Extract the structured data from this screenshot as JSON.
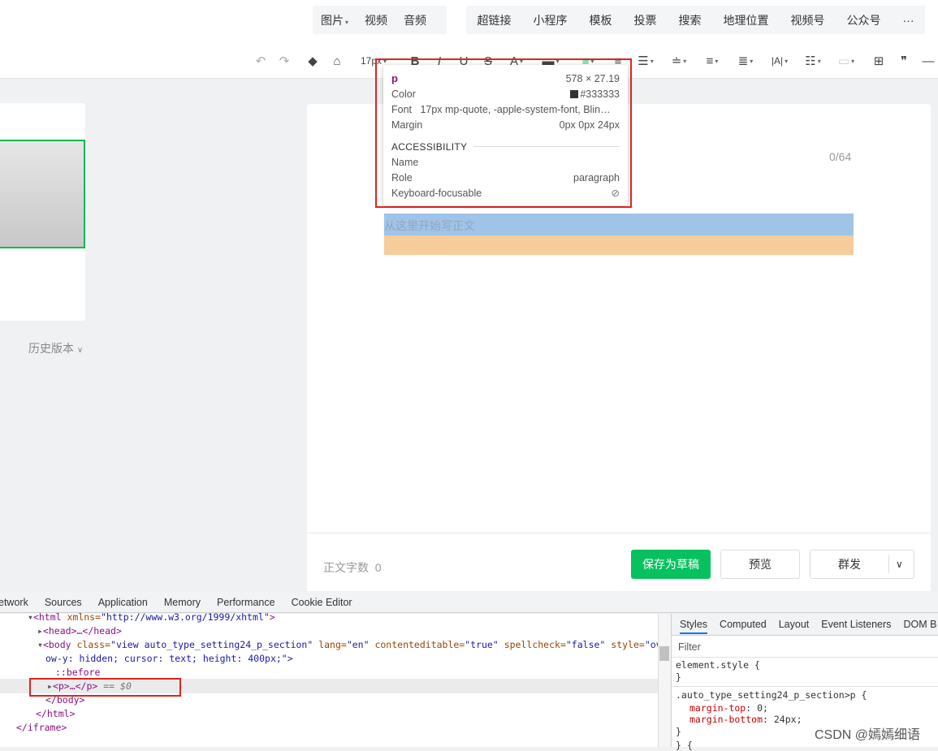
{
  "top_menu": {
    "group1": [
      "图片",
      "视频",
      "音频"
    ],
    "group2": [
      "超链接",
      "小程序",
      "模板",
      "投票",
      "搜索",
      "地理位置",
      "视频号",
      "公众号"
    ],
    "more": "···"
  },
  "toolbar": {
    "undo": "↶",
    "redo": "↷",
    "format_painter": "◆",
    "clear": "⌂",
    "font_size": "17px",
    "bold": "B",
    "italic": "I",
    "underline": "U",
    "strike": "S",
    "font_color": "A",
    "bg_color": "▬",
    "align_color": "≡",
    "align": "≡",
    "indent": "☰",
    "line_height": "≐",
    "para_before": "≡",
    "para_after": "≣",
    "letter_spacing": "|A|",
    "list": "☷",
    "disabled": "▭",
    "table": "⊞",
    "quote": "❞",
    "divider": "—",
    "dropdown": "▾"
  },
  "history": "历史版本",
  "editor": {
    "title_counter": "0/64",
    "placeholder": "从这里开始写正文"
  },
  "tooltip": {
    "tag": "p",
    "size": "578 × 27.19",
    "color_label": "Color",
    "color_value": "#333333",
    "font_label": "Font",
    "font_value": "17px mp-quote, -apple-system-font, Blin…",
    "margin_label": "Margin",
    "margin_value": "0px 0px 24px",
    "accessibility": "ACCESSIBILITY",
    "name_label": "Name",
    "role_label": "Role",
    "role_value": "paragraph",
    "keyboard_label": "Keyboard-focusable"
  },
  "bottom": {
    "word_count": "正文字数  0",
    "save_draft": "保存为草稿",
    "preview": "预览",
    "publish": "群发"
  },
  "devtools": {
    "tabs": [
      "etwork",
      "Sources",
      "Application",
      "Memory",
      "Performance",
      "Cookie Editor"
    ],
    "dom": {
      "html_open": "<html ",
      "html_attr": "xmlns=",
      "html_val": "\"http://www.w3.org/1999/xhtml\"",
      "html_close": ">",
      "head": "<head>…</head>",
      "body_open": "<body ",
      "body_class_attr": "class=",
      "body_class_val": "\"view auto_type_setting24_p_section\"",
      "body_lang_attr": " lang=",
      "body_lang_val": "\"en\"",
      "body_ce_attr": " contenteditable=",
      "body_ce_val": "\"true\"",
      "body_sc_attr": " spellcheck=",
      "body_sc_val": "\"false\"",
      "body_style_attr": " style=",
      "body_style_val": "\"overfl",
      "body_cont": "ow-y: hidden; cursor: text; height: 400px;\">",
      "before": "::before",
      "p_node": "<p>…</p>",
      "p_eq": " == $0",
      "body_end": "</body>",
      "html_end": "</html>",
      "iframe_end": "</iframe>"
    },
    "styles_tabs": [
      "Styles",
      "Computed",
      "Layout",
      "Event Listeners",
      "DOM B"
    ],
    "filter": "Filter",
    "element_style": "element.style {",
    "close_brace": "}",
    "rule_selector": ".auto_type_setting24_p_section>p {",
    "rule_prop1": "margin-top",
    "rule_val1": "0;",
    "rule_prop2": "margin-bottom",
    "rule_val2": "24px;",
    "next_rule": "} {"
  },
  "watermark": "CSDN @嫣嫣细语",
  "colors": {
    "accent_green": "#07c160",
    "highlight_red": "#e0241e",
    "content_blue": "#9fc4e8",
    "margin_orange": "#f7cc9b"
  }
}
